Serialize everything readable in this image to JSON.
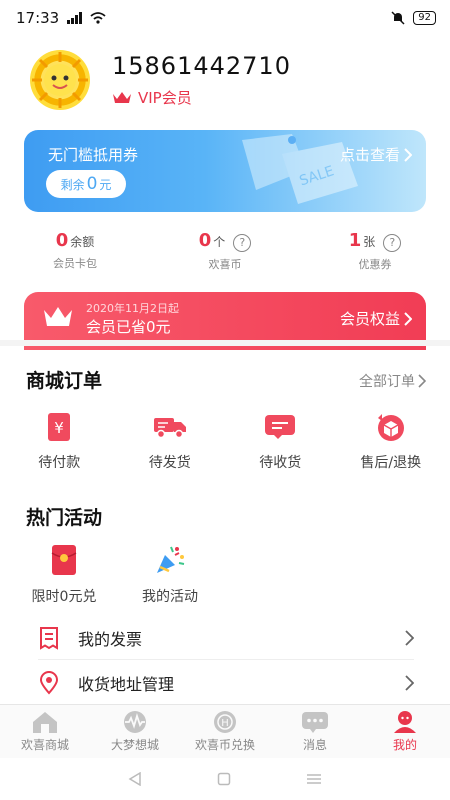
{
  "status_bar": {
    "time": "17:33",
    "signal": "4G",
    "battery": "92"
  },
  "profile": {
    "phone": "15861442710",
    "vip_label": "VIP会员"
  },
  "coupon_banner": {
    "title": "无门槛抵用券",
    "remaining_prefix": "剩余",
    "remaining_value": "0",
    "remaining_unit": "元",
    "link": "点击查看"
  },
  "stats": [
    {
      "value": "0",
      "unit": "余额",
      "sub": "会员卡包",
      "help": false
    },
    {
      "value": "0",
      "unit": "个",
      "sub": "欢喜币",
      "help": true
    },
    {
      "value": "1",
      "unit": "张",
      "sub": "优惠券",
      "help": true
    }
  ],
  "vip_banner": {
    "date": "2020年11月2日起",
    "saved": "会员已省0元",
    "link": "会员权益"
  },
  "orders": {
    "title": "商城订单",
    "all_link": "全部订单",
    "items": [
      {
        "label": "待付款",
        "icon": "yuan-card-icon"
      },
      {
        "label": "待发货",
        "icon": "truck-icon"
      },
      {
        "label": "待收货",
        "icon": "message-card-icon"
      },
      {
        "label": "售后/退换",
        "icon": "return-box-icon"
      }
    ]
  },
  "activities": {
    "title": "热门活动",
    "items": [
      {
        "label": "限时0元兑",
        "icon": "red-envelope-icon"
      },
      {
        "label": "我的活动",
        "icon": "party-popper-icon"
      }
    ]
  },
  "list": [
    {
      "label": "我的发票",
      "icon": "invoice-icon"
    },
    {
      "label": "收货地址管理",
      "icon": "location-pin-icon"
    }
  ],
  "tabs": [
    {
      "label": "欢喜商城",
      "icon": "home-icon",
      "active": false
    },
    {
      "label": "大梦想城",
      "icon": "wave-icon",
      "active": false
    },
    {
      "label": "欢喜币兑换",
      "icon": "coin-icon",
      "active": false
    },
    {
      "label": "消息",
      "icon": "chat-icon",
      "active": false
    },
    {
      "label": "我的",
      "icon": "person-icon",
      "active": true
    }
  ],
  "colors": {
    "accent": "#e8364c",
    "coupon_blue": "#3e9cf2"
  }
}
